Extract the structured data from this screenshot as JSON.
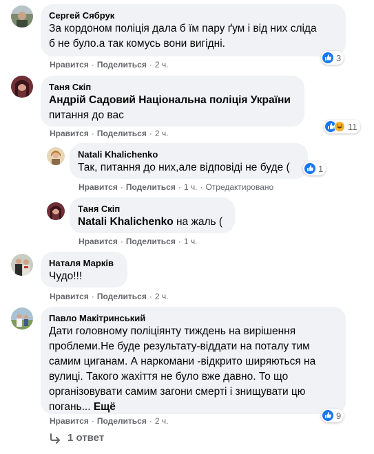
{
  "actions": {
    "like": "Нравится",
    "share": "Поделиться",
    "dot": "·"
  },
  "comments": [
    {
      "author": "Сергей Сябрук",
      "text_lines": [
        "За кордоном поліція дала б їм пару ґум і від них сліда",
        "б не було.а так комусь вони вигідні."
      ],
      "time": "2 ч.",
      "reactions": "3",
      "reaction_icons": [
        "like-icon"
      ]
    },
    {
      "author": "Таня Скіп",
      "mention": "Андрій Садовий Національна поліція України",
      "text": "питання до вас",
      "time": "2 ч.",
      "reactions": "11",
      "reaction_icons": [
        "like-icon",
        "haha-icon"
      ]
    },
    {
      "author": "Natali Khalichenko",
      "text": "Так, питання до них,але відповіді не буде (",
      "time": "1 ч.",
      "edited": "Отредактировано",
      "reactions": "1",
      "reaction_icons": [
        "like-icon"
      ]
    },
    {
      "author": "Таня Скіп",
      "mention": "Natali Khalichenko",
      "text": "на жаль (",
      "time": "1 ч."
    },
    {
      "author": "Наталя Марків",
      "text": "Чудо!!!",
      "time": "2 ч."
    },
    {
      "author": "Павло Макітринський",
      "text_lines": [
        "Дати головному поліціянту тиждень на вирішення",
        "проблеми.Не буде результату-віддати на поталу тим",
        "самим циганам. А наркомани -відкрито ширяються на",
        "вулиці. Такого жахіття не було вже давно. То що",
        "організовувати самим загони смерті і знищувати цю",
        "погань..."
      ],
      "more": "Ещё",
      "time": "2 ч.",
      "reactions": "9",
      "reaction_icons": [
        "like-icon"
      ]
    }
  ],
  "replies_link": "1 ответ",
  "colors": {
    "bubble": "#f0f2f5",
    "meta": "#65676b",
    "like": "#1877f2",
    "haha": "#f7b125"
  }
}
